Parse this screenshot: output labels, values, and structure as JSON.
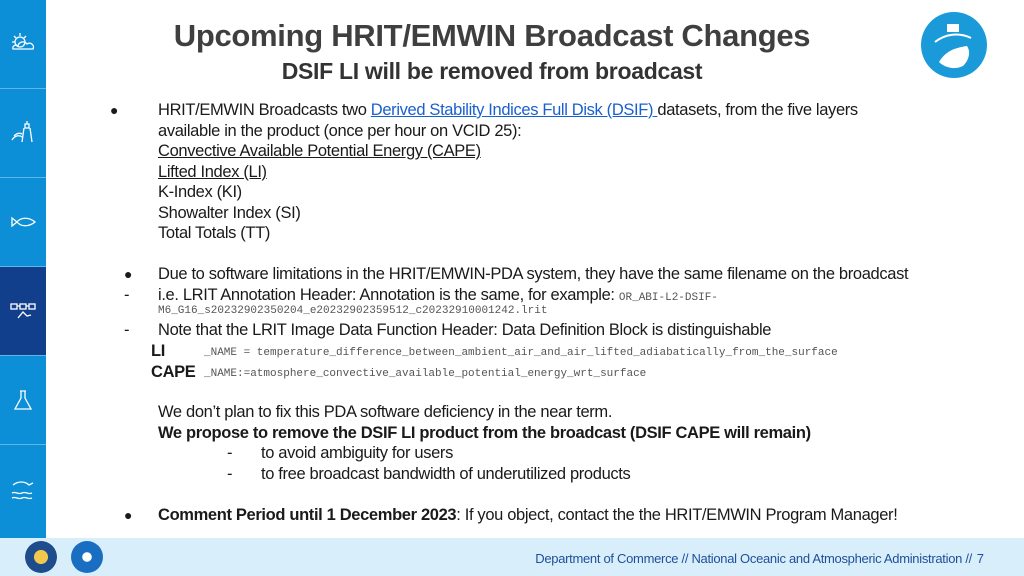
{
  "header": {
    "title": "Upcoming HRIT/EMWIN Broadcast Changes",
    "subtitle": "DSIF LI will be removed from broadcast"
  },
  "sidebar": {
    "items": [
      {
        "icon": "weather-icon"
      },
      {
        "icon": "lighthouse-icon"
      },
      {
        "icon": "fish-icon"
      },
      {
        "icon": "satellite-icon",
        "active": true
      },
      {
        "icon": "flask-icon"
      },
      {
        "icon": "ocean-icon"
      }
    ],
    "active_color": "#123f8c",
    "color": "#0d8fd8"
  },
  "body": {
    "p1_a": "HRIT/EMWIN Broadcasts two ",
    "p1_link": "Derived Stability Indices Full Disk (DSIF) ",
    "p1_b": "datasets, from the five layers",
    "p1_c": "available in the product (once per hour on VCID 25):",
    "layers": [
      "Convective Available Potential Energy (CAPE)",
      "Lifted Index (LI)",
      "K-Index (KI)",
      "Showalter Index (SI)",
      "Total Totals (TT)"
    ],
    "p2": "Due to software limitations in the HRIT/EMWIN-PDA system, they have the same filename on the broadcast",
    "p3_a": "i.e. LRIT Annotation Header: Annotation is the same, for example: ",
    "p3_m1": "OR_ABI-L2-DSIF-",
    "p3_m2": "M6_G16_s20232902350204_e20232902359512_c20232910001242.lrit",
    "p4": "Note that the LRIT Image Data Function Header: Data Definition Block is distinguishable",
    "li_label": "LI",
    "li_value": "_NAME = temperature_difference_between_ambient_air_and_air_lifted_adiabatically_from_the_surface",
    "cape_label": "CAPE",
    "cape_value": "_NAME:=atmosphere_convective_available_potential_energy_wrt_surface",
    "p5": "We don’t plan to fix this PDA software deficiency in the near term.",
    "p6": "We propose to remove the DSIF LI product from the  broadcast (DSIF CAPE will remain)",
    "reasons": [
      "to avoid ambiguity for users",
      "to free broadcast bandwidth of underutilized products"
    ],
    "p7_b": "Comment Period until 1 December 2023",
    "p7": ": If you object, contact the the HRIT/EMWIN Program Manager!",
    "bullet": "●",
    "dash": "-"
  },
  "footer": {
    "text": "Department of Commerce  //  National Oceanic and Atmospheric Administration  //",
    "page": "7"
  }
}
